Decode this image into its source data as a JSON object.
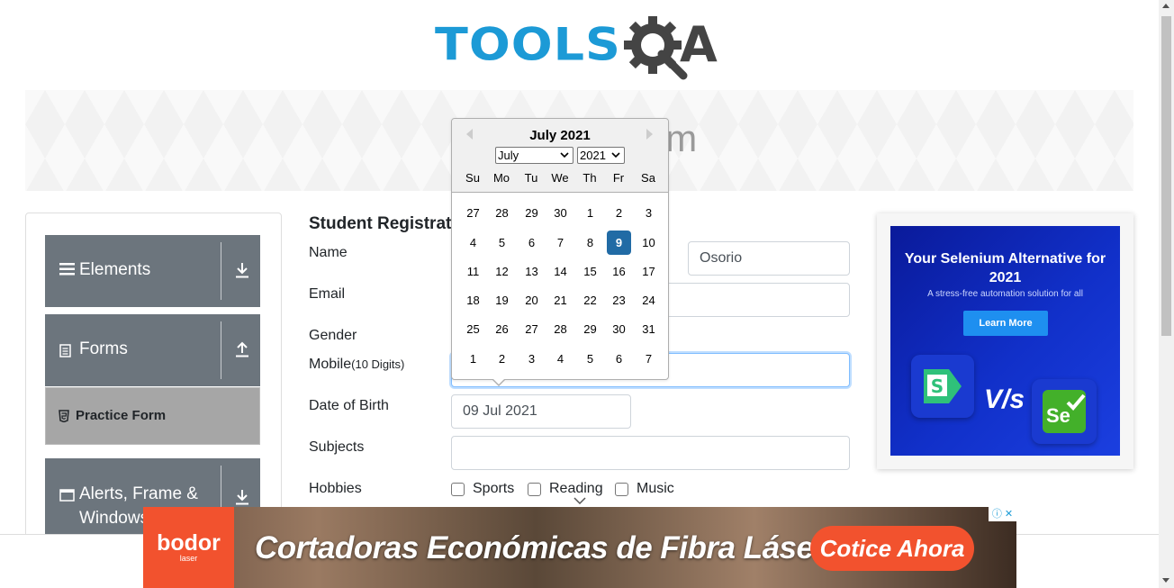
{
  "header": {
    "logo_text": "TOOLS",
    "logo_suffix": "A",
    "banner_title": "Practice Form"
  },
  "sidebar": {
    "groups": [
      {
        "label": "Elements",
        "icon": "menu-icon",
        "toggle_icon": "download-arrow-icon"
      },
      {
        "label": "Forms",
        "icon": "document-icon",
        "toggle_icon": "upload-arrow-icon"
      },
      {
        "label": "Alerts, Frame & Windows",
        "icon": "window-icon",
        "toggle_icon": "download-arrow-icon"
      }
    ],
    "active_item": {
      "label": "Practice Form",
      "icon": "html5-icon"
    }
  },
  "form": {
    "title": "Student Registration Form",
    "labels": {
      "name": "Name",
      "email": "Email",
      "gender": "Gender",
      "mobile": "Mobile",
      "mobile_hint": "(10 Digits)",
      "dob": "Date of Birth",
      "subjects": "Subjects",
      "hobbies": "Hobbies"
    },
    "last_name_value": "Osorio",
    "dob_value": "09 Jul 2021",
    "hobbies": [
      "Sports",
      "Reading",
      "Music"
    ]
  },
  "datepicker": {
    "title": "July 2021",
    "month_select": "July",
    "year_select": "2021",
    "weekdays": [
      "Su",
      "Mo",
      "Tu",
      "We",
      "Th",
      "Fr",
      "Sa"
    ],
    "weeks": [
      [
        "27",
        "28",
        "29",
        "30",
        "1",
        "2",
        "3"
      ],
      [
        "4",
        "5",
        "6",
        "7",
        "8",
        "9",
        "10"
      ],
      [
        "11",
        "12",
        "13",
        "14",
        "15",
        "16",
        "17"
      ],
      [
        "18",
        "19",
        "20",
        "21",
        "22",
        "23",
        "24"
      ],
      [
        "25",
        "26",
        "27",
        "28",
        "29",
        "30",
        "31"
      ],
      [
        "1",
        "2",
        "3",
        "4",
        "5",
        "6",
        "7"
      ]
    ],
    "selected_day": "9",
    "selected_color": "#216ba5"
  },
  "ad_right": {
    "title": "Your Selenium Alternative for 2021",
    "subtitle": "A stress-free automation solution for all",
    "button": "Learn More",
    "vs": "V/s",
    "logo2_text": "Se"
  },
  "ad_bottom": {
    "brand": "bodor",
    "brand_sub": "laser",
    "headline": "Cortadoras Económicas de Fibra Láser",
    "cta": "Cotice Ahora",
    "accent": "#f2522e"
  },
  "colors": {
    "logo_blue": "#1c9ad6",
    "sidebar_group": "#6c757d",
    "sidebar_active": "#a6a6a6",
    "focus_border": "#80bdff"
  }
}
